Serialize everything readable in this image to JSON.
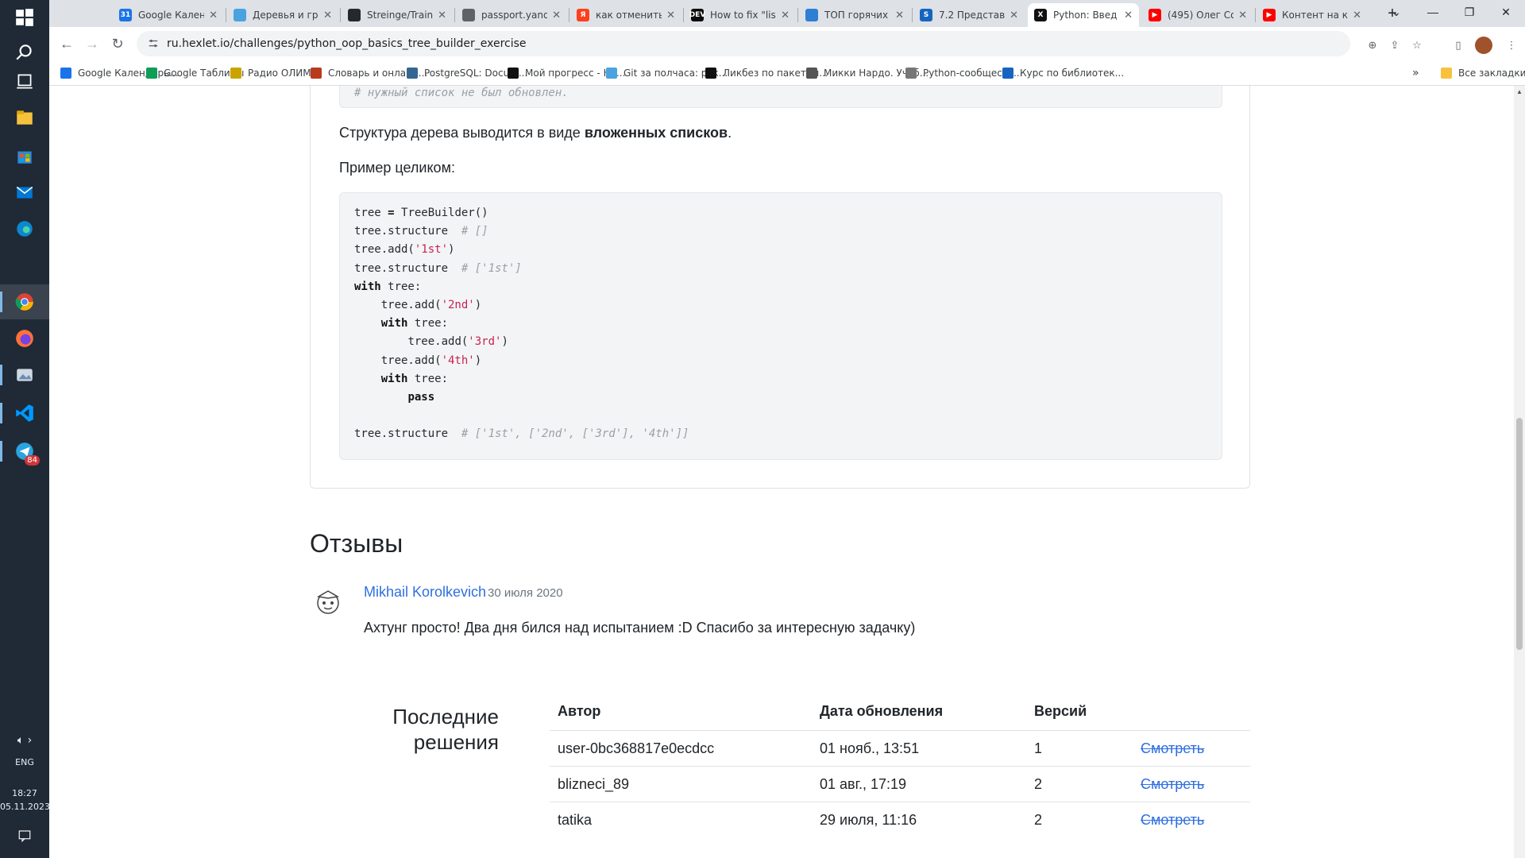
{
  "taskbar": {
    "language": "ENG",
    "time": "18:27",
    "date": "05.11.2023",
    "telegram_badge": "84"
  },
  "browser": {
    "tabs": [
      {
        "label": "Google Кален",
        "color": "#1a73e8",
        "glyph": "31"
      },
      {
        "label": "Деревья и гра",
        "color": "#4aa3df",
        "glyph": ""
      },
      {
        "label": "Streinge/Train",
        "color": "#24292e",
        "glyph": ""
      },
      {
        "label": "passport.yand",
        "color": "#5f6368",
        "glyph": ""
      },
      {
        "label": "как отменить",
        "color": "#fc3f1d",
        "glyph": "Я"
      },
      {
        "label": "How to fix \"lis",
        "color": "#0a0a0a",
        "glyph": "DEV"
      },
      {
        "label": "ТОП горячих",
        "color": "#2d7fd3",
        "glyph": ""
      },
      {
        "label": "7.2 Представл",
        "color": "#1565c0",
        "glyph": "S"
      },
      {
        "label": "Python: Введ",
        "color": "#111111",
        "glyph": "X"
      },
      {
        "label": "(495) Олег Со",
        "color": "#ff0000",
        "glyph": "▶"
      },
      {
        "label": "Контент на ка",
        "color": "#ff0000",
        "glyph": "▶"
      }
    ],
    "active_tab_index": 8,
    "new_tab": "+",
    "url": "ru.hexlet.io/challenges/python_oop_basics_tree_builder_exercise",
    "bookmarks": [
      {
        "label": "Google Календарь...",
        "color": "#1a73e8"
      },
      {
        "label": "Google Таблицы",
        "color": "#0f9d58"
      },
      {
        "label": "Радио ОЛИМП",
        "color": "#c9a400"
      },
      {
        "label": "Словарь и онлайн...",
        "color": "#b83b1e"
      },
      {
        "label": "PostgreSQL: Docum...",
        "color": "#336791"
      },
      {
        "label": "Мой прогресс - Не...",
        "color": "#111111"
      },
      {
        "label": "Git за полчаса: рук...",
        "color": "#4aa3df"
      },
      {
        "label": "Ликбез по пакетам...",
        "color": "#111111"
      },
      {
        "label": "Микки Нардо. Учеб...",
        "color": "#555555"
      },
      {
        "label": "Python-сообществ...",
        "color": "#777777"
      },
      {
        "label": "Курс по библиотек...",
        "color": "#1565c0"
      }
    ],
    "bookmarks_overflow": "»",
    "all_bookmarks": "Все закладки"
  },
  "content": {
    "partial_code_comment": "# нужный список не был обновлен.",
    "structure_text_before": "Структура дерева выводится в виде ",
    "structure_text_bold": "вложенных списков",
    "structure_text_after": ".",
    "example_label": "Пример целиком:",
    "code_lines": [
      {
        "indent": 0,
        "parts": [
          {
            "t": "tree "
          },
          {
            "t": "=",
            "c": "kw"
          },
          {
            "t": " TreeBuilder()"
          }
        ]
      },
      {
        "indent": 0,
        "parts": [
          {
            "t": "tree.structure  "
          },
          {
            "t": "# []",
            "c": "cm"
          }
        ]
      },
      {
        "indent": 0,
        "parts": [
          {
            "t": "tree.add("
          },
          {
            "t": "'1st'",
            "c": "str"
          },
          {
            "t": ")"
          }
        ]
      },
      {
        "indent": 0,
        "parts": [
          {
            "t": "tree.structure  "
          },
          {
            "t": "# ['1st']",
            "c": "cm"
          }
        ]
      },
      {
        "indent": 0,
        "parts": [
          {
            "t": "with",
            "c": "kw"
          },
          {
            "t": " tree:"
          }
        ]
      },
      {
        "indent": 4,
        "parts": [
          {
            "t": "tree.add("
          },
          {
            "t": "'2nd'",
            "c": "str"
          },
          {
            "t": ")"
          }
        ]
      },
      {
        "indent": 4,
        "parts": [
          {
            "t": "with",
            "c": "kw"
          },
          {
            "t": " tree:"
          }
        ]
      },
      {
        "indent": 8,
        "parts": [
          {
            "t": "tree.add("
          },
          {
            "t": "'3rd'",
            "c": "str"
          },
          {
            "t": ")"
          }
        ]
      },
      {
        "indent": 4,
        "parts": [
          {
            "t": "tree.add("
          },
          {
            "t": "'4th'",
            "c": "str"
          },
          {
            "t": ")"
          }
        ]
      },
      {
        "indent": 4,
        "parts": [
          {
            "t": "with",
            "c": "kw"
          },
          {
            "t": " tree:"
          }
        ]
      },
      {
        "indent": 8,
        "parts": [
          {
            "t": "pass",
            "c": "kw"
          }
        ]
      },
      {
        "indent": 0,
        "parts": []
      },
      {
        "indent": 0,
        "parts": [
          {
            "t": "tree.structure  "
          },
          {
            "t": "# ['1st', ['2nd', ['3rd'], '4th']]",
            "c": "cm"
          }
        ]
      }
    ],
    "reviews_title": "Отзывы",
    "review": {
      "author": "Mikhail Korolkevich",
      "date": "30 июля 2020",
      "text": "Ахтунг просто! Два дня бился над испытанием :D Спасибо за интересную задачку)"
    },
    "solutions_title_line1": "Последние",
    "solutions_title_line2": "решения",
    "solutions_headers": [
      "Автор",
      "Дата обновления",
      "Версий"
    ],
    "solutions": [
      {
        "author": "user-0bc368817e0ecdcc",
        "date": "01 нояб., 13:51",
        "versions": "1",
        "link": "Смотреть"
      },
      {
        "author": "blizneci_89",
        "date": "01 авг., 17:19",
        "versions": "2",
        "link": "Смотреть"
      },
      {
        "author": "tatika",
        "date": "29 июля, 11:16",
        "versions": "2",
        "link": "Смотреть"
      }
    ]
  }
}
